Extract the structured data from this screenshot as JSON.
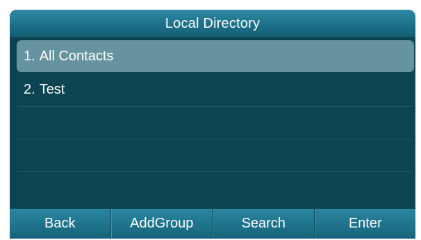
{
  "header": {
    "title": "Local Directory"
  },
  "list": {
    "items": [
      {
        "number": "1.",
        "label": "All Contacts",
        "selected": true
      },
      {
        "number": "2.",
        "label": "Test",
        "selected": false
      }
    ]
  },
  "softkeys": [
    {
      "label": "Back"
    },
    {
      "label": "AddGroup"
    },
    {
      "label": "Search"
    },
    {
      "label": "Enter"
    }
  ],
  "colors": {
    "screen_background": "#0c4452",
    "title_bar": "#1c7089",
    "selected_row": "#66939f",
    "softkey": "#1d7189",
    "text": "#ffffff"
  }
}
